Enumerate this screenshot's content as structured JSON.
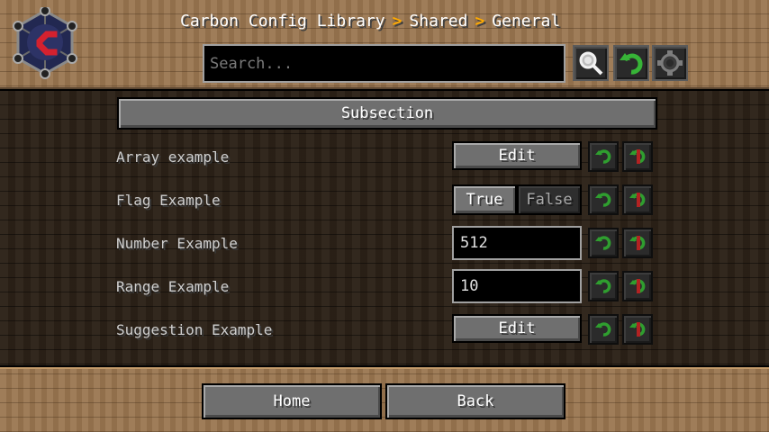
{
  "header": {
    "breadcrumb": [
      "Carbon Config Library",
      "Shared",
      "General"
    ],
    "breadcrumb_separator": ">",
    "search_placeholder": "Search...",
    "icons": [
      "carbon-logo-icon",
      "search-icon",
      "reset-icon",
      "gear-icon"
    ]
  },
  "main": {
    "subsection_label": "Subsection",
    "rows": [
      {
        "label": "Array example",
        "control": "button",
        "value": "Edit"
      },
      {
        "label": "Flag Example",
        "control": "toggle",
        "options": [
          "True",
          "False"
        ],
        "selected": "True"
      },
      {
        "label": "Number Example",
        "control": "text",
        "value": "512"
      },
      {
        "label": "Range Example",
        "control": "text",
        "value": "10"
      },
      {
        "label": "Suggestion Example",
        "control": "button",
        "value": "Edit"
      }
    ],
    "row_icons": [
      "reset-icon",
      "default-icon"
    ]
  },
  "footer": {
    "home_label": "Home",
    "back_label": "Back"
  },
  "colors": {
    "separator": "#ffaa00",
    "reset_green": "#2f9e2f",
    "default_red": "#b22222",
    "logo_red": "#d4212f",
    "logo_navy": "#222851"
  }
}
